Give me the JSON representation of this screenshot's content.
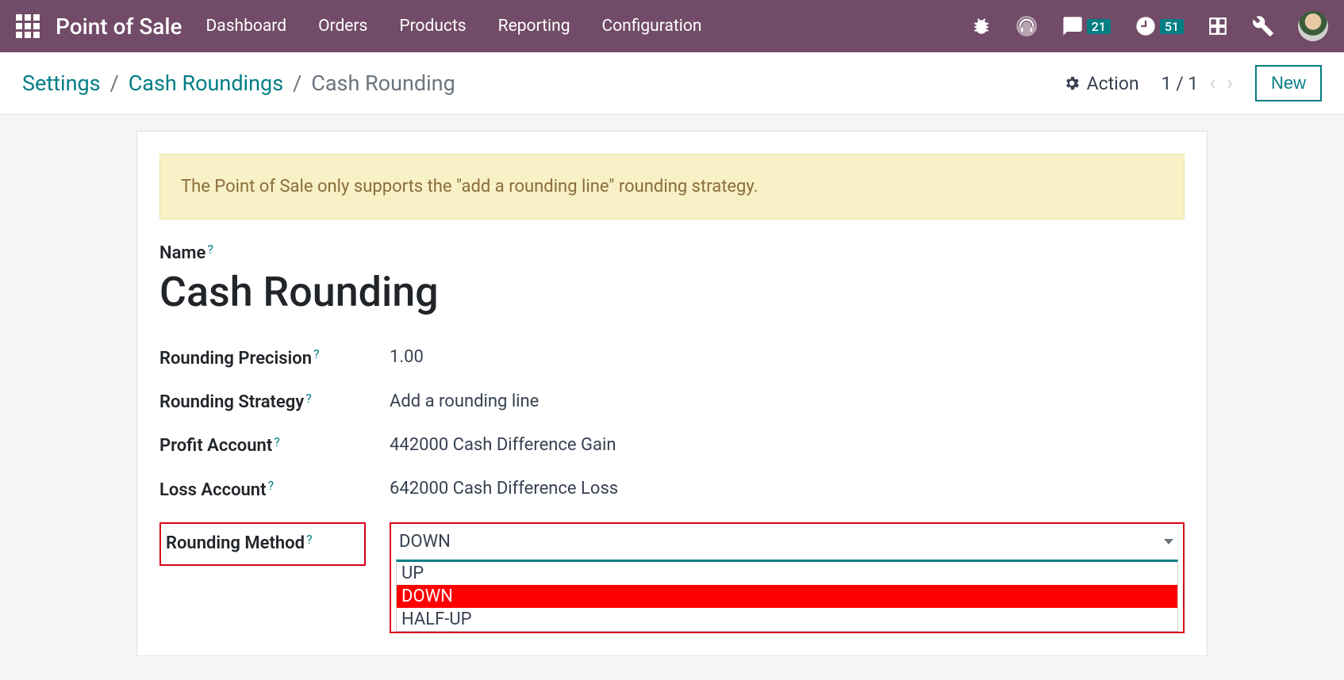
{
  "navbar": {
    "app_title": "Point of Sale",
    "menu": [
      "Dashboard",
      "Orders",
      "Products",
      "Reporting",
      "Configuration"
    ],
    "messages_badge": "21",
    "activities_badge": "51"
  },
  "control_panel": {
    "breadcrumb": {
      "root": "Settings",
      "parent": "Cash Roundings",
      "current": "Cash Rounding"
    },
    "action_label": "Action",
    "pager": "1 / 1",
    "new_label": "New"
  },
  "form": {
    "alert": "The Point of Sale only supports the \"add a rounding line\" rounding strategy.",
    "name_label": "Name",
    "name_value": "Cash Rounding",
    "fields": {
      "precision_label": "Rounding Precision",
      "precision_value": "1.00",
      "strategy_label": "Rounding Strategy",
      "strategy_value": "Add a rounding line",
      "profit_label": "Profit Account",
      "profit_value": "442000 Cash Difference Gain",
      "loss_label": "Loss Account",
      "loss_value": "642000 Cash Difference Loss",
      "method_label": "Rounding Method",
      "method_value": "DOWN",
      "method_options": [
        "UP",
        "DOWN",
        "HALF-UP"
      ]
    }
  }
}
